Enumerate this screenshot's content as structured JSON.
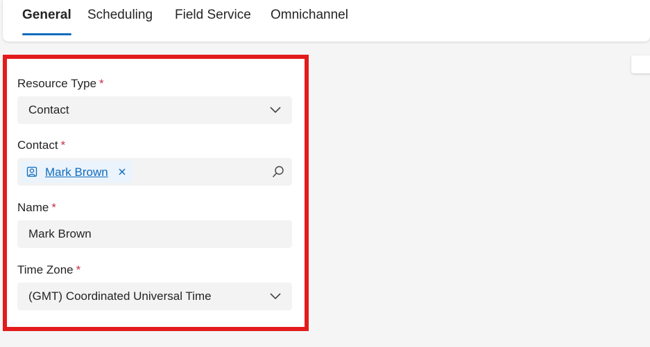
{
  "tabs": [
    {
      "label": "General",
      "active": true
    },
    {
      "label": "Scheduling",
      "active": false
    },
    {
      "label": "Field Service",
      "active": false
    },
    {
      "label": "Omnichannel",
      "active": false
    }
  ],
  "form": {
    "resource_type": {
      "label": "Resource Type",
      "required_mark": "*",
      "value": "Contact"
    },
    "contact": {
      "label": "Contact",
      "required_mark": "*",
      "value": "Mark Brown"
    },
    "name": {
      "label": "Name",
      "required_mark": "*",
      "value": "Mark Brown"
    },
    "time_zone": {
      "label": "Time Zone",
      "required_mark": "*",
      "value": "(GMT) Coordinated Universal Time"
    }
  },
  "colors": {
    "accent": "#0f6cbd",
    "highlight_border": "#e31b1b",
    "required": "#c4314b"
  },
  "icons": [
    "chevron-down-icon",
    "contact-person-icon",
    "close-icon",
    "search-icon"
  ]
}
